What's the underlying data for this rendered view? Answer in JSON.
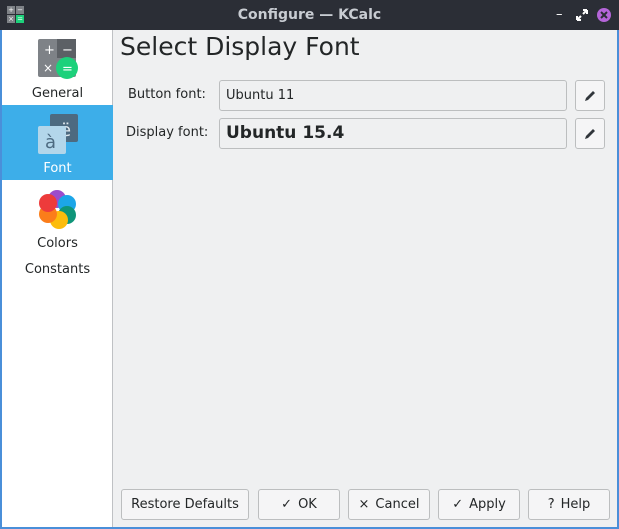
{
  "window": {
    "title": "Configure — KCalc"
  },
  "sidebar": {
    "items": [
      {
        "label": "General"
      },
      {
        "label": "Font"
      },
      {
        "label": "Colors"
      },
      {
        "label": "Constants"
      }
    ]
  },
  "page": {
    "title": "Select Display Font",
    "button_font": {
      "label": "Button font:",
      "value": "Ubuntu 11"
    },
    "display_font": {
      "label": "Display font:",
      "value": "Ubuntu 15.4"
    }
  },
  "buttons": {
    "restore": "Restore Defaults",
    "ok": "OK",
    "cancel": "Cancel",
    "apply": "Apply",
    "help": "Help"
  },
  "colors": {
    "accent": "#3daee9",
    "titlebar": "#2b2e36",
    "border": "#4a8fd9"
  }
}
